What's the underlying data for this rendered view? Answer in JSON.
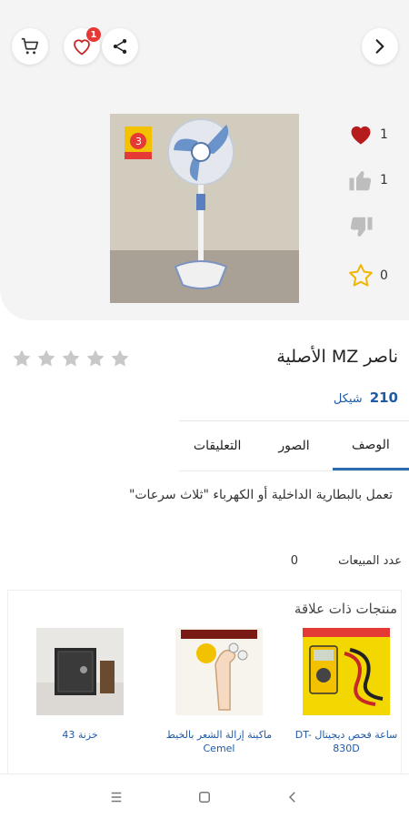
{
  "header": {
    "wishlist_count": "1"
  },
  "stats": {
    "likes": "1",
    "thumbs_up": "1",
    "stars": "0"
  },
  "product": {
    "title": "ناصر MZ الأصلية",
    "price": "210",
    "currency": "شيكل",
    "rating": 0,
    "description": "تعمل بالبطارية الداخلية أو الكهرباء \"ثلاث سرعات\"",
    "sales_label": "عدد المبيعات",
    "sales_count": "0"
  },
  "tabs": [
    {
      "label": "الوصف",
      "active": true
    },
    {
      "label": "الصور",
      "active": false
    },
    {
      "label": "التعليقات",
      "active": false
    }
  ],
  "related": {
    "title": "منتجات ذات علاقة",
    "items": [
      {
        "name": "ساعة فحص ديجيتال DT-830D"
      },
      {
        "name": "ماكينة إزالة الشعر بالخيط Cemel"
      },
      {
        "name": "خزنة 43"
      }
    ]
  },
  "colors": {
    "accent": "#2b6cb0",
    "price": "#1e5aa8",
    "heart": "#c62828",
    "badge": "#e53935"
  }
}
